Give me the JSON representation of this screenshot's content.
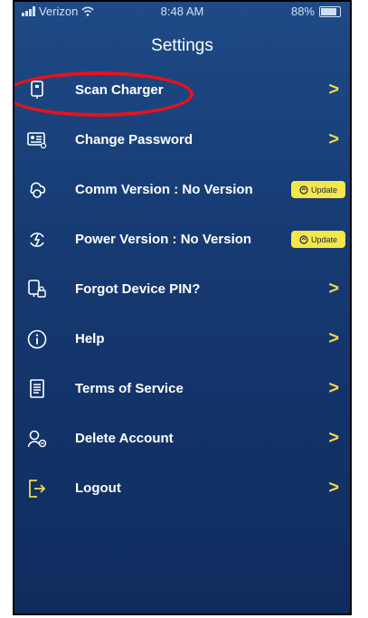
{
  "status_bar": {
    "carrier": "Verizon",
    "time": "8:48 AM",
    "battery": "88%"
  },
  "page": {
    "title": "Settings"
  },
  "menu": {
    "items": [
      {
        "label": "Scan Charger",
        "icon": "charger-icon",
        "accessory": "chevron"
      },
      {
        "label": "Change Password",
        "icon": "id-card-icon",
        "accessory": "chevron"
      },
      {
        "label": "Comm Version : No Version",
        "icon": "cloud-sync-icon",
        "accessory": "update"
      },
      {
        "label": "Power Version : No Version",
        "icon": "power-cycle-icon",
        "accessory": "update"
      },
      {
        "label": "Forgot Device PIN?",
        "icon": "device-lock-icon",
        "accessory": "chevron"
      },
      {
        "label": "Help",
        "icon": "info-icon",
        "accessory": "chevron"
      },
      {
        "label": "Terms of Service",
        "icon": "document-icon",
        "accessory": "chevron"
      },
      {
        "label": "Delete Account",
        "icon": "user-remove-icon",
        "accessory": "chevron"
      },
      {
        "label": "Logout",
        "icon": "logout-icon",
        "accessory": "chevron"
      }
    ],
    "update_label": "Update",
    "chevron_glyph": ">"
  },
  "colors": {
    "background": "#163a72",
    "accent": "#f2d94a",
    "update_badge": "#f5e64a",
    "highlight": "#e8121b"
  }
}
